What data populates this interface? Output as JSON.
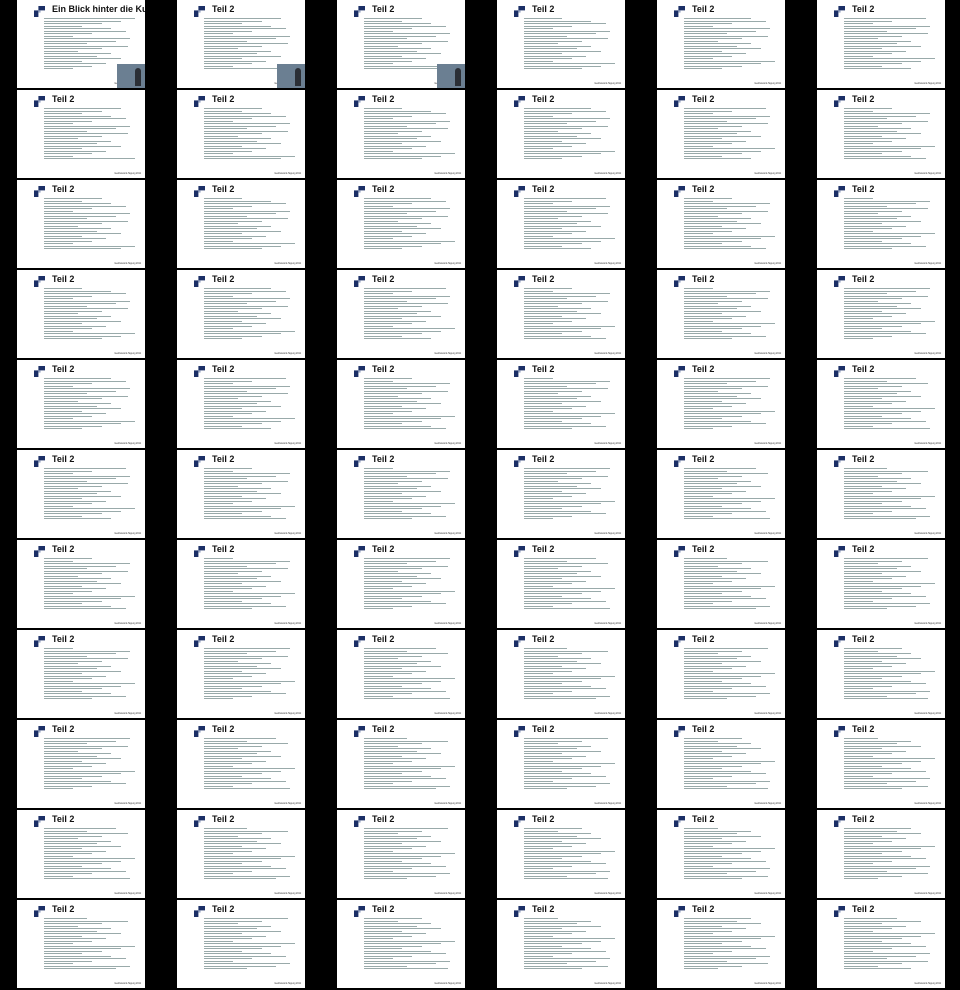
{
  "grid": {
    "columns": 6,
    "rows": 11,
    "first_slide_title": "Ein Blick hinter die Kulissen",
    "default_title": "Teil 2",
    "footer_text": "GeoNetwork-Tagung 2011",
    "slides_with_video": [
      0,
      1,
      2
    ]
  }
}
